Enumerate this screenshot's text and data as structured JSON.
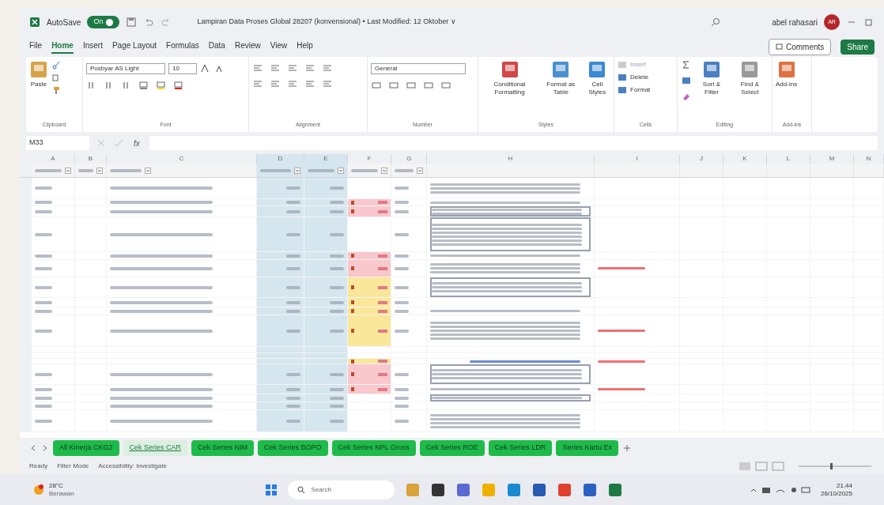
{
  "title_bar": {
    "autosave_label": "AutoSave",
    "autosave_on": true,
    "autosave_state": "On",
    "title": "Lampiran Data Proses Global 28207 (konvensional) • Last Modified: 12 Oktober ∨",
    "user": "abel rahasari",
    "avatar": "AR"
  },
  "menu_tabs": [
    {
      "label": "File",
      "selected": false
    },
    {
      "label": "Home",
      "selected": true
    },
    {
      "label": "Insert",
      "selected": false
    },
    {
      "label": "Page Layout",
      "selected": false
    },
    {
      "label": "Formulas",
      "selected": false
    },
    {
      "label": "Data",
      "selected": false
    },
    {
      "label": "Review",
      "selected": false
    },
    {
      "label": "View",
      "selected": false
    },
    {
      "label": "Help",
      "selected": false
    }
  ],
  "comments_button": "Comments",
  "share_button": "Share",
  "ribbon": {
    "paste": "Paste",
    "font_name": "Posbyar AS Light",
    "font_size": "10",
    "number_format": "General",
    "conditional_formatting": "Conditional Formatting",
    "format_as_table": "Format as Table",
    "cell_styles": "Cell Styles",
    "insert": "Insert",
    "delete": "Delete",
    "format": "Format",
    "sort_filter": "Sort & Filter",
    "find_select": "Find & Select",
    "add_ins": "Add-ins",
    "group_labels": [
      "Clipboard",
      "Font",
      "Alignment",
      "Number",
      "Styles",
      "Cells",
      "Editing",
      "Add-ins"
    ]
  },
  "name_box": "M33",
  "columns": [
    "A",
    "B",
    "C",
    "D",
    "E",
    "F",
    "G",
    "H",
    "I",
    "J",
    "K",
    "L",
    "M",
    "N"
  ],
  "formula_fx": "fx",
  "rows": [
    {
      "kind": "plain"
    },
    {
      "kind": "pink"
    },
    {
      "kind": "pink"
    },
    {
      "kind": "plain"
    },
    {
      "kind": "pink"
    },
    {
      "kind": "pink"
    },
    {
      "kind": "yellow"
    },
    {
      "kind": "yellow"
    },
    {
      "kind": "yellow"
    },
    {
      "kind": "yellow"
    },
    {
      "kind": "plain"
    },
    {
      "kind": "plain"
    },
    {
      "kind": "yellow"
    },
    {
      "kind": "pink"
    },
    {
      "kind": "pink"
    },
    {
      "kind": "plain"
    },
    {
      "kind": "plain"
    },
    {
      "kind": "plain"
    }
  ],
  "sheet_tabs": [
    {
      "label": "All Kinerja CKG2",
      "selected": false
    },
    {
      "label": "Cek Series CAR",
      "selected": true
    },
    {
      "label": "Cek Series NIM",
      "selected": false
    },
    {
      "label": "Cek Series BOPO",
      "selected": false
    },
    {
      "label": "Cek Series NPL Gross",
      "selected": false
    },
    {
      "label": "Cek Series ROE",
      "selected": false
    },
    {
      "label": "Cek Series LDR",
      "selected": false
    },
    {
      "label": "Series Kartu Ex",
      "selected": false
    }
  ],
  "status_bar": [
    "Ready",
    "Filter Mode",
    "Accessibility: Investigate"
  ],
  "taskbar": {
    "temperature": "28°C",
    "weather": "Berawan",
    "search": "Search",
    "time": "21.44",
    "date": "26/10/2025"
  }
}
